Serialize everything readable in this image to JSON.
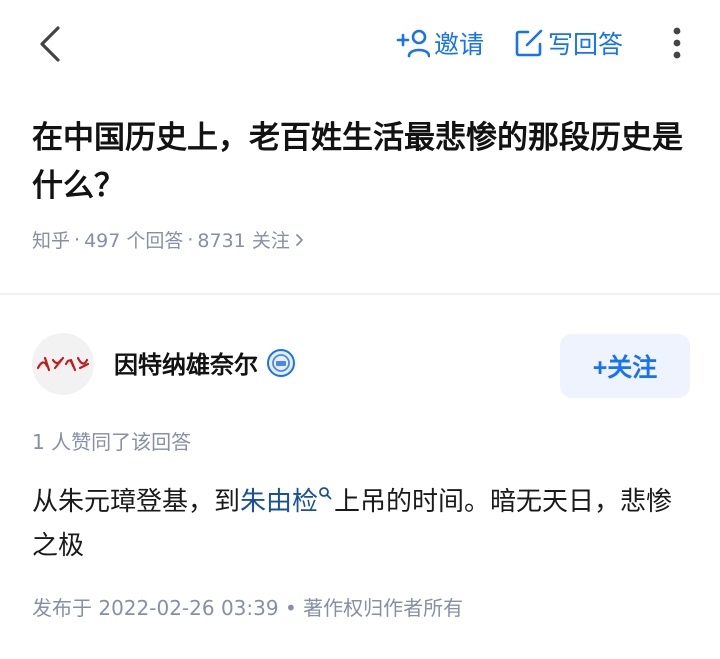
{
  "header": {
    "back_icon": "chevron-left-icon",
    "invite_label": "邀请",
    "invite_icon": "add-user-icon",
    "write_label": "写回答",
    "write_icon": "edit-icon",
    "more_icon": "vertical-dots-icon",
    "accent_color": "#1772f6"
  },
  "question": {
    "title": "在中国历史上，老百姓生活最悲惨的那段历史是什么？",
    "meta": {
      "source": "知乎",
      "answers": "497 个回答",
      "followers": "8731 关注",
      "chevron_icon": "chevron-right-icon"
    }
  },
  "answer": {
    "author": {
      "avatar_text": "為人民服務",
      "name": "因特纳雄奈尔",
      "badge_icon": "verified-badge-icon"
    },
    "follow_label": "+关注",
    "likes_text": "1 人赞同了该回答",
    "content": {
      "before": "从朱元璋登基，到",
      "link": "朱由检",
      "after": "上吊的时间。暗无天日，悲惨之极"
    },
    "footer": {
      "published": "发布于 2022-02-26 03:39",
      "sep": "•",
      "copyright": "著作权归作者所有"
    }
  }
}
